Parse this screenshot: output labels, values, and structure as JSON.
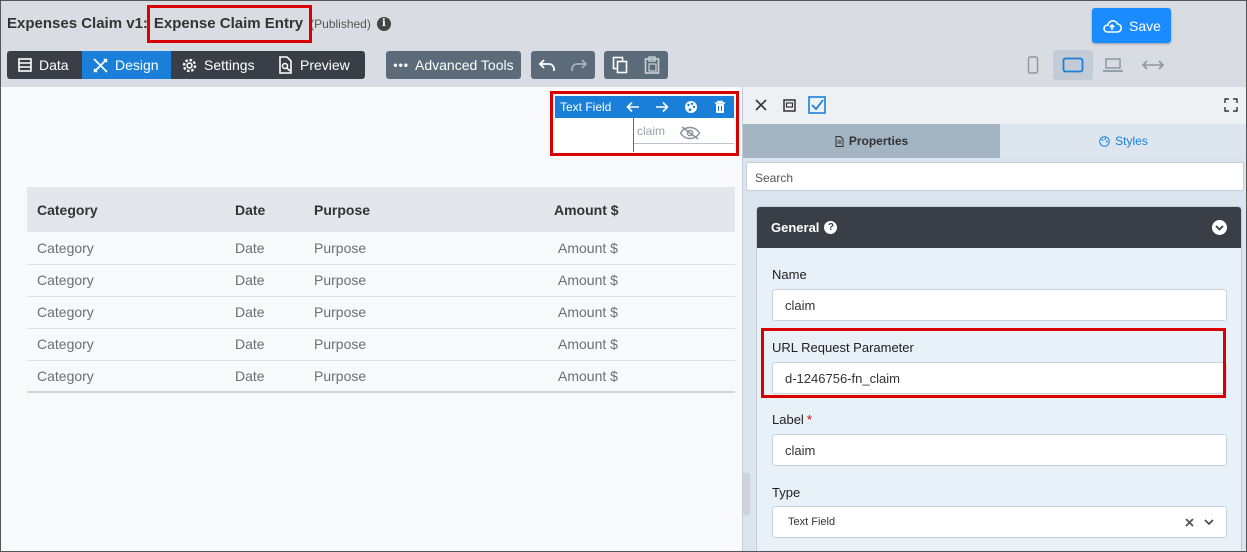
{
  "header": {
    "app_title": "Expenses Claim v1:",
    "form_title": "Expense Claim Entry",
    "status": "(Published)",
    "save_label": "Save"
  },
  "toolbar": {
    "data_label": "Data",
    "design_label": "Design",
    "settings_label": "Settings",
    "preview_label": "Preview",
    "advanced_label": "Advanced Tools"
  },
  "canvas": {
    "field_toolbar_label": "Text Field",
    "field_value": "claim"
  },
  "table": {
    "headers": [
      "Category",
      "Date",
      "Purpose",
      "Amount $"
    ],
    "rows": [
      [
        "Category",
        "Date",
        "Purpose",
        "Amount $"
      ],
      [
        "Category",
        "Date",
        "Purpose",
        "Amount $"
      ],
      [
        "Category",
        "Date",
        "Purpose",
        "Amount $"
      ],
      [
        "Category",
        "Date",
        "Purpose",
        "Amount $"
      ],
      [
        "Category",
        "Date",
        "Purpose",
        "Amount $"
      ]
    ]
  },
  "panel": {
    "tabs": {
      "properties": "Properties",
      "styles": "Styles"
    },
    "search_placeholder": "Search",
    "section_title": "General",
    "fields": {
      "name_label": "Name",
      "name_value": "claim",
      "url_label": "URL Request Parameter",
      "url_value": "d-1246756-fn_claim",
      "label_label": "Label",
      "label_required": "*",
      "label_value": "claim",
      "type_label": "Type",
      "type_value": "Text Field"
    }
  },
  "colors": {
    "accent": "#1a7fd8",
    "highlight": "#d90000",
    "dark": "#3a3f47"
  }
}
